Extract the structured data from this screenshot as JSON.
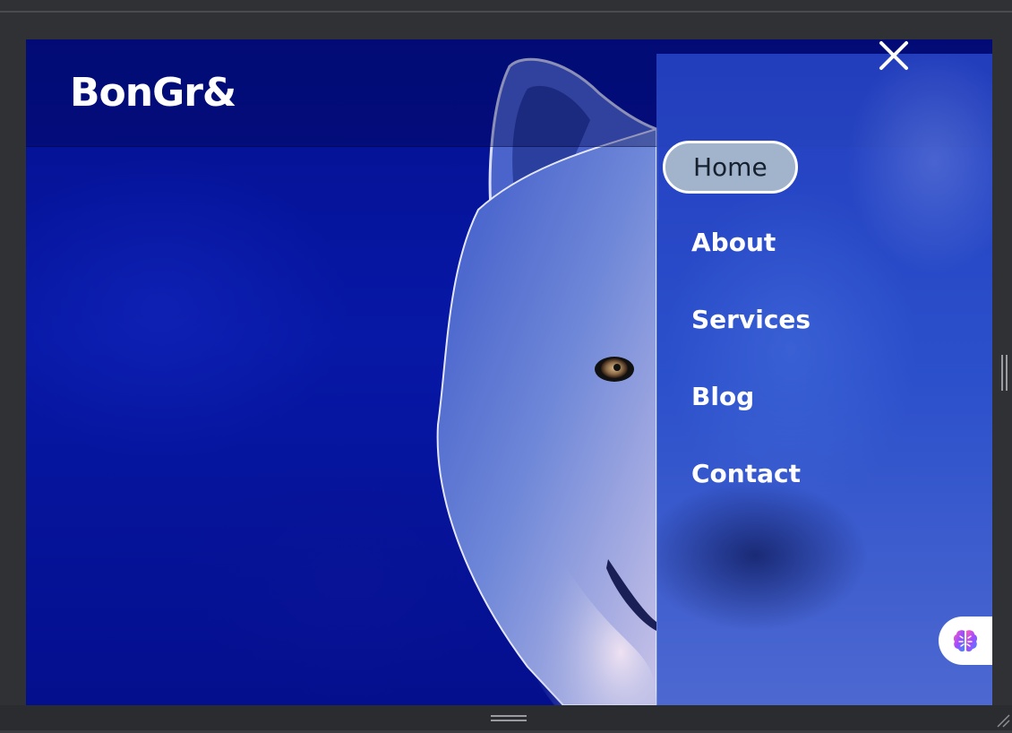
{
  "site": {
    "logo": "BonGr&"
  },
  "nav": {
    "items": [
      {
        "label": "Home",
        "active": true
      },
      {
        "label": "About",
        "active": false
      },
      {
        "label": "Services",
        "active": false
      },
      {
        "label": "Blog",
        "active": false
      },
      {
        "label": "Contact",
        "active": false
      }
    ],
    "active_bg": "#a2b3cc"
  },
  "icons": {
    "close": "close-icon",
    "assistant": "brain-icon"
  },
  "colors": {
    "background": "#05118e",
    "text": "#ffffff"
  }
}
